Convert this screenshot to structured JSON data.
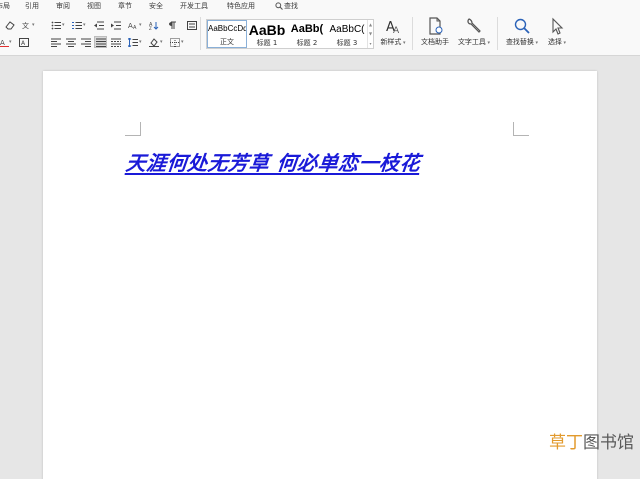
{
  "menu": {
    "tabs": [
      "布局",
      "引用",
      "审阅",
      "视图",
      "章节",
      "安全",
      "开发工具",
      "特色应用"
    ],
    "search_label": "查找"
  },
  "ribbon": {
    "style_gallery": [
      {
        "preview": "AaBbCcDd",
        "name": "正文"
      },
      {
        "preview": "AaBb",
        "name": "标题 1"
      },
      {
        "preview": "AaBb(",
        "name": "标题 2"
      },
      {
        "preview": "AaBbC(",
        "name": "标题 3"
      }
    ],
    "new_style_label": "新样式",
    "doc_assistant_label": "文档助手",
    "text_tools_label": "文字工具",
    "find_replace_label": "查找替换",
    "select_label": "选择"
  },
  "document": {
    "text": "天涯何处无芳草 何必单恋一枝花",
    "text_color": "#1a1ad8"
  },
  "watermark": {
    "part_a": "草丁",
    "part_b": "图书馆"
  },
  "colors": {
    "accent_blue": "#1a1ad8",
    "watermark_orange": "#e29a2d"
  }
}
